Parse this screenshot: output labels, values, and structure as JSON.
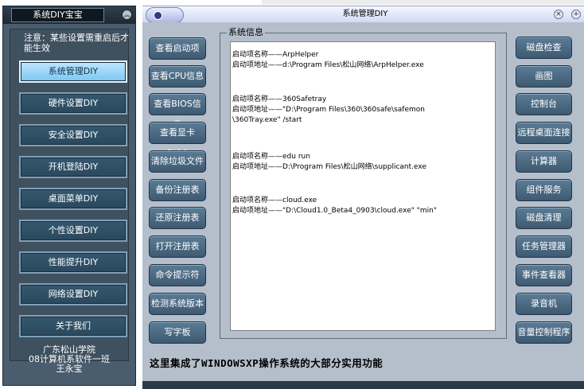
{
  "sidebar": {
    "title": "系统DIY宝宝",
    "notice": "注意：某些设置需重启后才能生效",
    "items": [
      {
        "label": "系统管理DIY",
        "active": true
      },
      {
        "label": "硬件设置DIY",
        "active": false
      },
      {
        "label": "安全设置DIY",
        "active": false
      },
      {
        "label": "开机登陆DIY",
        "active": false
      },
      {
        "label": "桌面菜单DIY",
        "active": false
      },
      {
        "label": "个性设置DIY",
        "active": false
      },
      {
        "label": "性能提升DIY",
        "active": false
      },
      {
        "label": "网络设置DIY",
        "active": false
      },
      {
        "label": "关于我们",
        "active": false
      }
    ],
    "footer": [
      "广东松山学院",
      "08计算机系软件一班",
      "王永宝"
    ]
  },
  "window": {
    "title": "系统管理DIY"
  },
  "left_buttons": [
    "查看启动项",
    "查看CPU信息",
    "查看BIOS信息",
    "查看显卡BIOS",
    "清除垃圾文件",
    "备份注册表",
    "还原注册表",
    "打开注册表",
    "命令提示符",
    "检测系统版本",
    "写字板"
  ],
  "right_buttons": [
    "磁盘检查",
    "画图",
    "控制台",
    "远程桌面连接",
    "计算器",
    "组件服务",
    "磁盘清理",
    "任务管理器",
    "事件查看器",
    "录音机",
    "音量控制程序"
  ],
  "group_label": "系统信息",
  "startup_entries": [
    {
      "name_line": "启动项名称——ArpHelper",
      "path_lines": [
        "启动项地址——d:\\Program Files\\松山网络\\ArpHelper.exe"
      ]
    },
    {
      "name_line": "启动项名称——360Safetray",
      "path_lines": [
        "启动项地址——\"D:\\Program Files\\360\\360safe\\safemon",
        "\\360Tray.exe\" /start"
      ]
    },
    {
      "name_line": "启动项名称——edu run",
      "path_lines": [
        "启动项地址——D:\\Program Files\\松山网络\\supplicant.exe"
      ]
    },
    {
      "name_line": "启动项名称——cloud.exe",
      "path_lines": [
        "启动项地址——\"D:\\Cloud1.0_Beta4_0903\\cloud.exe\" \"min\""
      ]
    }
  ],
  "caption": "这里集成了WINDOWSXP操作系统的大部分实用功能",
  "icons": {
    "collapse": "chevron-up-icon",
    "window": "app-window-icon"
  },
  "colors": {
    "sidebar_bg": "#4a5d6e",
    "active_btn": "#7cc7f2",
    "body_bg": "#b5bfcc"
  }
}
